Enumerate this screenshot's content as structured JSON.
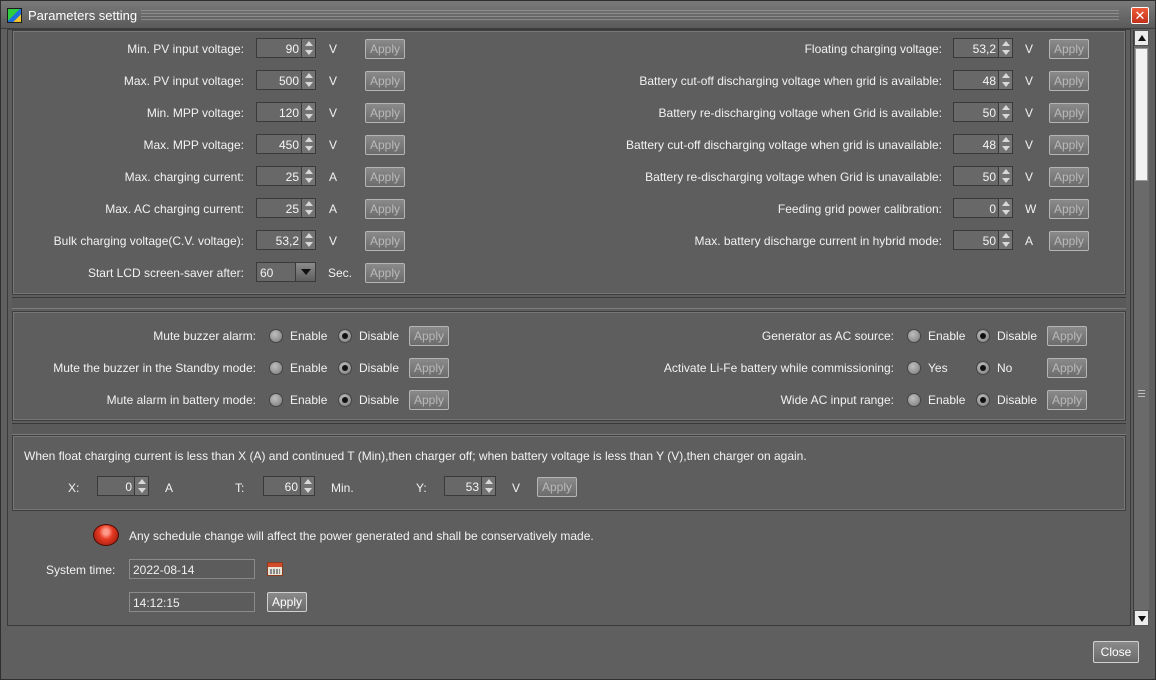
{
  "window": {
    "title": "Parameters setting",
    "close_glyph": "✕"
  },
  "voltage_left": [
    {
      "label": "Min. PV input voltage:",
      "value": "90",
      "unit": "V",
      "apply": "Apply"
    },
    {
      "label": "Max. PV input voltage:",
      "value": "500",
      "unit": "V",
      "apply": "Apply"
    },
    {
      "label": "Min. MPP voltage:",
      "value": "120",
      "unit": "V",
      "apply": "Apply"
    },
    {
      "label": "Max. MPP voltage:",
      "value": "450",
      "unit": "V",
      "apply": "Apply"
    },
    {
      "label": "Max. charging current:",
      "value": "25",
      "unit": "A",
      "apply": "Apply"
    },
    {
      "label": "Max. AC charging current:",
      "value": "25",
      "unit": "A",
      "apply": "Apply"
    },
    {
      "label": "Bulk charging voltage(C.V. voltage):",
      "value": "53,2",
      "unit": "V",
      "apply": "Apply"
    }
  ],
  "screensaver": {
    "label": "Start LCD screen-saver after:",
    "value": "60",
    "unit": "Sec.",
    "apply": "Apply"
  },
  "voltage_right": [
    {
      "label": "Floating charging voltage:",
      "value": "53,2",
      "unit": "V",
      "apply": "Apply"
    },
    {
      "label": "Battery cut-off discharging voltage when grid is available:",
      "value": "48",
      "unit": "V",
      "apply": "Apply"
    },
    {
      "label": "Battery re-discharging voltage when Grid is available:",
      "value": "50",
      "unit": "V",
      "apply": "Apply"
    },
    {
      "label": "Battery cut-off discharging voltage when grid is unavailable:",
      "value": "48",
      "unit": "V",
      "apply": "Apply"
    },
    {
      "label": "Battery re-discharging voltage when Grid is unavailable:",
      "value": "50",
      "unit": "V",
      "apply": "Apply"
    },
    {
      "label": "Feeding grid power calibration:",
      "value": "0",
      "unit": "W",
      "apply": "Apply"
    },
    {
      "label": "Max. battery discharge current in hybrid mode:",
      "value": "50",
      "unit": "A",
      "apply": "Apply"
    }
  ],
  "toggles_left": [
    {
      "label": "Mute buzzer alarm:",
      "opt1": "Enable",
      "opt2": "Disable",
      "selected": 2,
      "apply": "Apply"
    },
    {
      "label": "Mute the buzzer in the Standby mode:",
      "opt1": "Enable",
      "opt2": "Disable",
      "selected": 2,
      "apply": "Apply"
    },
    {
      "label": "Mute alarm in battery mode:",
      "opt1": "Enable",
      "opt2": "Disable",
      "selected": 2,
      "apply": "Apply"
    }
  ],
  "toggles_right": [
    {
      "label": "Generator as AC source:",
      "opt1": "Enable",
      "opt2": "Disable",
      "selected": 2,
      "apply": "Apply"
    },
    {
      "label": "Activate Li-Fe battery while commissioning:",
      "opt1": "Yes",
      "opt2": "No",
      "selected": 2,
      "apply": "Apply"
    },
    {
      "label": "Wide AC input range:",
      "opt1": "Enable",
      "opt2": "Disable",
      "selected": 2,
      "apply": "Apply"
    }
  ],
  "float_charge": {
    "description": "When float charging current is less than X (A) and continued T (Min),then charger off; when battery voltage is less than Y (V),then charger on again.",
    "x_label": "X:",
    "x_value": "0",
    "x_unit": "A",
    "t_label": "T:",
    "t_value": "60",
    "t_unit": "Min.",
    "y_label": "Y:",
    "y_value": "53",
    "y_unit": "V",
    "apply": "Apply"
  },
  "schedule": {
    "warning": "Any schedule change will affect the power generated and shall be conservatively made.",
    "system_time_label": "System time:",
    "date": "2022-08-14",
    "time": "14:12:15",
    "apply": "Apply"
  },
  "footer": {
    "close_label": "Close"
  },
  "icons": {
    "app": "inverter-app-icon",
    "warning": "red-alarm-light-icon",
    "calendar": "calendar-icon"
  }
}
